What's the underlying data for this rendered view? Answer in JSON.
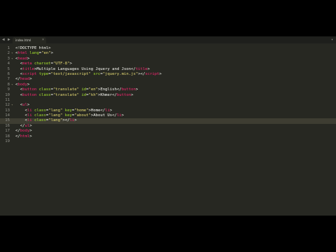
{
  "tab": {
    "filename": "index.html",
    "close": "×"
  },
  "nav": {
    "left": "◀",
    "right": "▶",
    "menu": "▾"
  },
  "code_lines": [
    {
      "n": "1",
      "fold": "",
      "indent": "",
      "tokens": [
        {
          "t": "<!DOCTYPE html>",
          "c": "kw"
        }
      ]
    },
    {
      "n": "2",
      "fold": "▾",
      "indent": "",
      "tokens": [
        {
          "t": "<",
          "c": "kw"
        },
        {
          "t": "html",
          "c": "tag"
        },
        {
          "t": " lang",
          "c": "attr"
        },
        {
          "t": "=",
          "c": "kw"
        },
        {
          "t": "\"en\"",
          "c": "str"
        },
        {
          "t": ">",
          "c": "kw"
        }
      ]
    },
    {
      "n": "3",
      "fold": "▾",
      "indent": "",
      "tokens": [
        {
          "t": "<",
          "c": "kw"
        },
        {
          "t": "head",
          "c": "tag"
        },
        {
          "t": ">",
          "c": "kw"
        }
      ]
    },
    {
      "n": "4",
      "fold": "",
      "indent": "  ",
      "tokens": [
        {
          "t": "<",
          "c": "kw"
        },
        {
          "t": "meta",
          "c": "tag"
        },
        {
          "t": " charset",
          "c": "attr"
        },
        {
          "t": "=",
          "c": "kw"
        },
        {
          "t": "\"UTF-8\"",
          "c": "str"
        },
        {
          "t": ">",
          "c": "kw"
        }
      ]
    },
    {
      "n": "5",
      "fold": "",
      "indent": "  ",
      "tokens": [
        {
          "t": "<",
          "c": "kw"
        },
        {
          "t": "title",
          "c": "tag"
        },
        {
          "t": ">Multiple Languages Using Jquery and Json</",
          "c": "kw"
        },
        {
          "t": "title",
          "c": "tag"
        },
        {
          "t": ">",
          "c": "kw"
        }
      ]
    },
    {
      "n": "6",
      "fold": "",
      "indent": "  ",
      "tokens": [
        {
          "t": "<",
          "c": "kw"
        },
        {
          "t": "script",
          "c": "tag"
        },
        {
          "t": " type",
          "c": "attr"
        },
        {
          "t": "=",
          "c": "kw"
        },
        {
          "t": "\"text/javascript\"",
          "c": "str"
        },
        {
          "t": " src",
          "c": "attr"
        },
        {
          "t": "=",
          "c": "kw"
        },
        {
          "t": "\"jquery.min.js\"",
          "c": "str"
        },
        {
          "t": "></",
          "c": "kw"
        },
        {
          "t": "script",
          "c": "tag"
        },
        {
          "t": ">",
          "c": "kw"
        }
      ]
    },
    {
      "n": "7",
      "fold": "",
      "indent": "",
      "tokens": [
        {
          "t": "</",
          "c": "kw"
        },
        {
          "t": "head",
          "c": "tag"
        },
        {
          "t": ">",
          "c": "kw"
        }
      ]
    },
    {
      "n": "8",
      "fold": "▾",
      "indent": "",
      "tokens": [
        {
          "t": "<",
          "c": "kw"
        },
        {
          "t": "body",
          "c": "tag"
        },
        {
          "t": ">",
          "c": "kw"
        }
      ]
    },
    {
      "n": "9",
      "fold": "",
      "indent": "  ",
      "tokens": [
        {
          "t": "<",
          "c": "kw"
        },
        {
          "t": "button",
          "c": "tag"
        },
        {
          "t": " class",
          "c": "attr"
        },
        {
          "t": "=",
          "c": "kw"
        },
        {
          "t": "\"translate\"",
          "c": "str"
        },
        {
          "t": " id",
          "c": "attr"
        },
        {
          "t": "=",
          "c": "kw"
        },
        {
          "t": "\"en\"",
          "c": "str"
        },
        {
          "t": ">English</",
          "c": "kw"
        },
        {
          "t": "button",
          "c": "tag"
        },
        {
          "t": ">",
          "c": "kw"
        }
      ]
    },
    {
      "n": "10",
      "fold": "",
      "indent": "  ",
      "tokens": [
        {
          "t": "<",
          "c": "kw"
        },
        {
          "t": "button",
          "c": "tag"
        },
        {
          "t": " class",
          "c": "attr"
        },
        {
          "t": "=",
          "c": "kw"
        },
        {
          "t": "\"translate\"",
          "c": "str"
        },
        {
          "t": " id",
          "c": "attr"
        },
        {
          "t": "=",
          "c": "kw"
        },
        {
          "t": "\"kh\"",
          "c": "str"
        },
        {
          "t": ">Khmer</",
          "c": "kw"
        },
        {
          "t": "button",
          "c": "tag"
        },
        {
          "t": ">",
          "c": "kw"
        }
      ]
    },
    {
      "n": "11",
      "fold": "",
      "indent": "",
      "tokens": []
    },
    {
      "n": "12",
      "fold": "▾",
      "indent": "  ",
      "tokens": [
        {
          "t": "<",
          "c": "kw"
        },
        {
          "t": "ul",
          "c": "tag"
        },
        {
          "t": ">",
          "c": "kw"
        }
      ]
    },
    {
      "n": "13",
      "fold": "",
      "indent": "    ",
      "tokens": [
        {
          "t": "<",
          "c": "kw"
        },
        {
          "t": "li",
          "c": "tag"
        },
        {
          "t": " class",
          "c": "attr"
        },
        {
          "t": "=",
          "c": "kw"
        },
        {
          "t": "\"lang\"",
          "c": "str"
        },
        {
          "t": " key",
          "c": "attr"
        },
        {
          "t": "=",
          "c": "kw"
        },
        {
          "t": "\"home\"",
          "c": "str"
        },
        {
          "t": ">Home</",
          "c": "kw"
        },
        {
          "t": "li",
          "c": "tag"
        },
        {
          "t": ">",
          "c": "kw"
        }
      ]
    },
    {
      "n": "14",
      "fold": "",
      "indent": "    ",
      "tokens": [
        {
          "t": "<",
          "c": "kw"
        },
        {
          "t": "li",
          "c": "tag"
        },
        {
          "t": " class",
          "c": "attr"
        },
        {
          "t": "=",
          "c": "kw"
        },
        {
          "t": "\"lang\"",
          "c": "str"
        },
        {
          "t": " key",
          "c": "attr"
        },
        {
          "t": "=",
          "c": "kw"
        },
        {
          "t": "\"about\"",
          "c": "str"
        },
        {
          "t": ">About Us</",
          "c": "kw"
        },
        {
          "t": "li",
          "c": "tag"
        },
        {
          "t": ">",
          "c": "kw"
        }
      ]
    },
    {
      "n": "15",
      "fold": "",
      "indent": "    ",
      "active": true,
      "tokens": [
        {
          "t": "<",
          "c": "kw"
        },
        {
          "t": "li",
          "c": "tag"
        },
        {
          "t": " class",
          "c": "attr"
        },
        {
          "t": "=",
          "c": "kw"
        },
        {
          "t": "\"lang\"",
          "c": "str"
        },
        {
          "t": "></",
          "c": "kw"
        },
        {
          "t": "li",
          "c": "tag"
        },
        {
          "t": ">",
          "c": "kw"
        }
      ]
    },
    {
      "n": "16",
      "fold": "",
      "indent": "  ",
      "tokens": [
        {
          "t": "</",
          "c": "kw"
        },
        {
          "t": "ul",
          "c": "tag"
        },
        {
          "t": ">",
          "c": "kw"
        }
      ]
    },
    {
      "n": "17",
      "fold": "",
      "indent": "",
      "tokens": [
        {
          "t": "</",
          "c": "kw"
        },
        {
          "t": "body",
          "c": "tag"
        },
        {
          "t": ">",
          "c": "kw"
        }
      ]
    },
    {
      "n": "18",
      "fold": "",
      "indent": "",
      "tokens": [
        {
          "t": "</",
          "c": "kw"
        },
        {
          "t": "html",
          "c": "tag"
        },
        {
          "t": ">",
          "c": "kw"
        }
      ]
    },
    {
      "n": "19",
      "fold": "",
      "indent": "",
      "tokens": []
    }
  ]
}
